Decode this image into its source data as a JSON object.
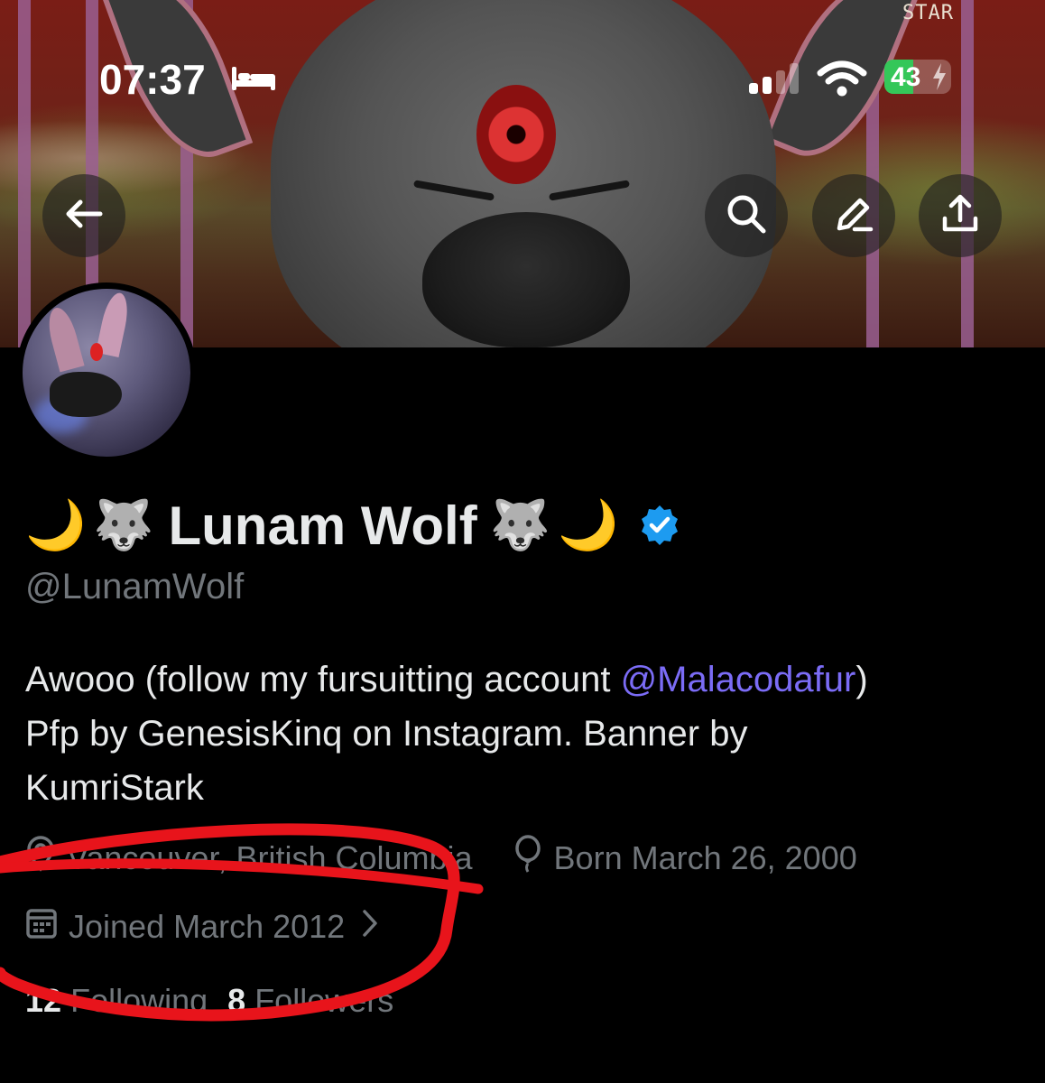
{
  "status_bar": {
    "time": "07:37",
    "battery_level": "43",
    "battery_fraction": 0.43,
    "icons": [
      "sleep-focus-icon",
      "cellular-signal-icon",
      "wifi-icon",
      "battery-charging-icon"
    ]
  },
  "banner": {
    "signature": "STAR"
  },
  "nav": {
    "buttons": [
      "back-arrow-icon",
      "search-icon",
      "edit-icon",
      "share-icon"
    ]
  },
  "profile": {
    "name_prefix_emoji": [
      "🌙",
      "🐺"
    ],
    "name": "Lunam Wolf",
    "name_suffix_emoji": [
      "🐺",
      "🌙"
    ],
    "verified": true,
    "handle": "@LunamWolf",
    "bio": {
      "line1_before": "Awooo (follow my fursuitting account ",
      "line1_mention": "@Malacodafur",
      "line1_after": ")",
      "line2": "Pfp by GenesisKinq on Instagram. Banner by",
      "line3": "KumriStark"
    },
    "location": "Vancouver, British Columbia",
    "birthday": "Born March 26, 2000",
    "joined": "Joined March 2012",
    "following_count": "12",
    "following_label": "Following",
    "followers_count": "8",
    "followers_label": "Followers"
  },
  "colors": {
    "background": "#000000",
    "text_primary": "#e7e9ea",
    "text_secondary": "#71767b",
    "mention": "#7b6cf6",
    "verified": "#1d9bf0",
    "battery_green": "#34c759",
    "annotation_red": "#e8141b"
  }
}
